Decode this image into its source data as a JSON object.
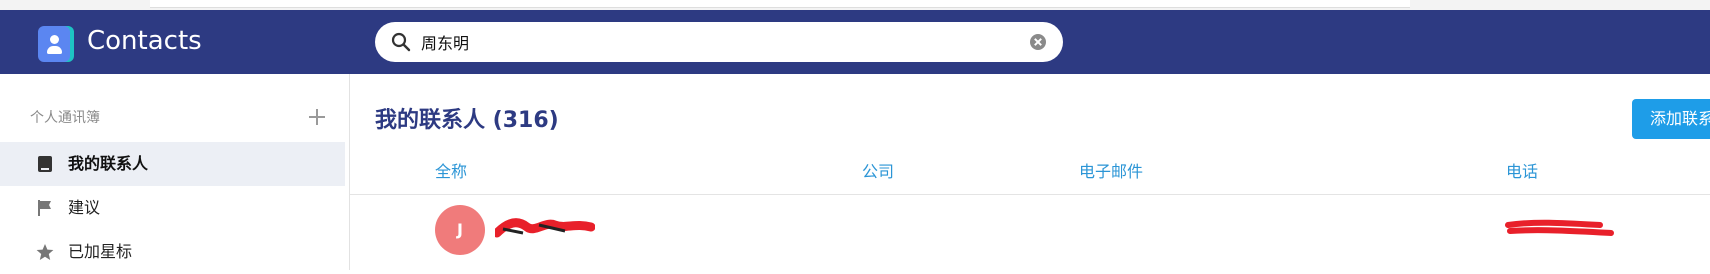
{
  "app": {
    "title": "Contacts"
  },
  "search": {
    "value": "周东明"
  },
  "sidebar": {
    "section_label": "个人通讯簿",
    "items": [
      {
        "label": "我的联系人",
        "icon": "address-book-icon",
        "active": true
      },
      {
        "label": "建议",
        "icon": "flag-icon",
        "active": false
      },
      {
        "label": "已加星标",
        "icon": "star-icon",
        "active": false
      }
    ]
  },
  "main": {
    "title": "我的联系人 (316)",
    "add_button": "添加联系人",
    "columns": {
      "name": "全称",
      "company": "公司",
      "email": "电子邮件",
      "phone": "电话"
    },
    "rows": [
      {
        "avatar_initial": "J"
      }
    ]
  },
  "colors": {
    "header": "#2d3a82",
    "accent": "#1e9de8",
    "column_header": "#2b95d6",
    "avatar": "#f07b7b",
    "redaction": "#e8202a"
  }
}
